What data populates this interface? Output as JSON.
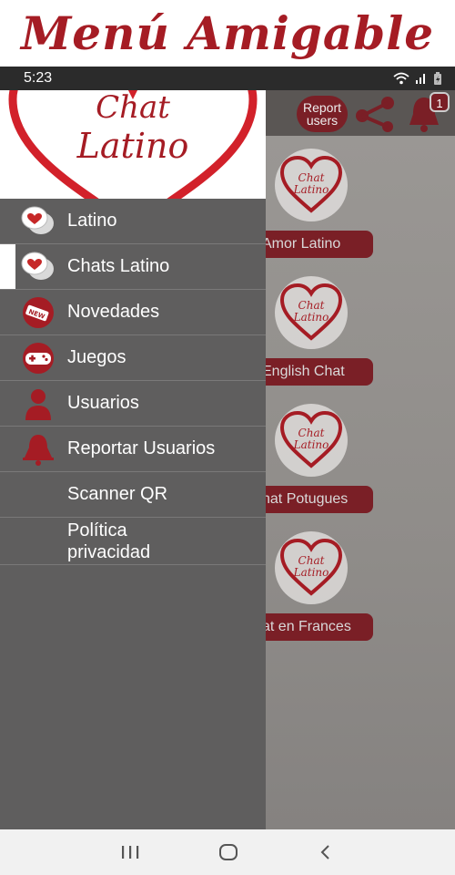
{
  "banner": {
    "title": "Menú Amigable"
  },
  "status": {
    "time": "5:23",
    "icons": [
      "wifi-icon",
      "signal-icon",
      "battery-icon"
    ]
  },
  "toolbar": {
    "report_label": "Report users",
    "notification_count": "1"
  },
  "rooms": [
    {
      "label": "Amor Latino"
    },
    {
      "label": "English Chat"
    },
    {
      "label": "hat Potugues"
    },
    {
      "label": "at en Frances"
    }
  ],
  "logo": {
    "line1": "Chat",
    "line2": "Latino"
  },
  "drawer": {
    "items": [
      {
        "label": "Latino",
        "icon": "chat-bubbles-icon"
      },
      {
        "label": "Chats Latino",
        "icon": "chat-bubbles-icon"
      },
      {
        "label": "Novedades",
        "icon": "new-tag-icon"
      },
      {
        "label": "Juegos",
        "icon": "gamepad-icon"
      },
      {
        "label": "Usuarios",
        "icon": "user-icon"
      },
      {
        "label": "Reportar Usuarios",
        "icon": "bell-icon"
      },
      {
        "label": "Scanner QR",
        "icon": ""
      },
      {
        "label": "Política privacidad",
        "icon": ""
      }
    ]
  },
  "colors": {
    "brand_red": "#a51c24",
    "drawer_bg": "#5f5e5e",
    "button_red": "#7a1f26"
  }
}
